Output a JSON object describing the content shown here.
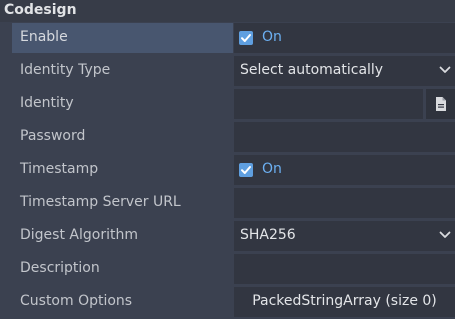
{
  "section": {
    "title": "Codesign"
  },
  "properties": {
    "enable": {
      "label": "Enable",
      "value": "On",
      "checked": true
    },
    "identity_type": {
      "label": "Identity Type",
      "value": "Select automatically"
    },
    "identity": {
      "label": "Identity",
      "value": ""
    },
    "password": {
      "label": "Password",
      "value": ""
    },
    "timestamp": {
      "label": "Timestamp",
      "value": "On",
      "checked": true
    },
    "timestamp_server_url": {
      "label": "Timestamp Server URL",
      "value": ""
    },
    "digest_algorithm": {
      "label": "Digest Algorithm",
      "value": "SHA256"
    },
    "description": {
      "label": "Description",
      "value": ""
    },
    "custom_options": {
      "label": "Custom Options",
      "value": "PackedStringArray (size 0)"
    }
  },
  "icons": {
    "checkbox": "checkmark-icon",
    "dropdown": "chevron-down-icon",
    "file": "file-icon"
  },
  "colors": {
    "accent": "#6cb0f2",
    "checkbox": "#5f9fe0",
    "selected_row": "#48566f",
    "background": "#3b4150"
  }
}
